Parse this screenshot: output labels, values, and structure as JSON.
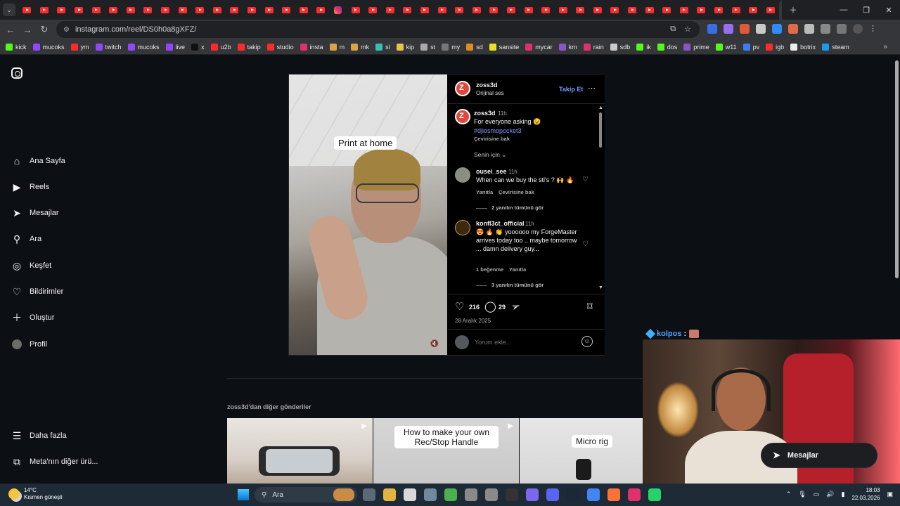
{
  "browser": {
    "url": "instagram.com/reel/DS0h0a8gXFZ/",
    "bookmarks": [
      "kick",
      "mucoks",
      "ym",
      "twitch",
      "mucoks",
      "live",
      "x",
      "u2b",
      "takip",
      "studio",
      "insta",
      "m",
      "mk",
      "sl",
      "kip",
      "st",
      "my",
      "sd",
      "sansite",
      "mycar",
      "km",
      "rain",
      "sdb",
      "ik",
      "dos",
      "prime",
      "w11",
      "pv",
      "igb",
      "botrix",
      "steam"
    ]
  },
  "sidebar": {
    "items": [
      {
        "label": "Ana Sayfa",
        "icon": "home-icon"
      },
      {
        "label": "Reels",
        "icon": "reels-icon"
      },
      {
        "label": "Mesajlar",
        "icon": "messages-icon"
      },
      {
        "label": "Ara",
        "icon": "search-icon"
      },
      {
        "label": "Keşfet",
        "icon": "explore-icon"
      },
      {
        "label": "Bildirimler",
        "icon": "heart-icon"
      },
      {
        "label": "Oluştur",
        "icon": "plus-icon"
      },
      {
        "label": "Profil",
        "icon": "avatar-icon"
      }
    ],
    "more": "Daha fazla",
    "meta": "Meta'nın diğer ürü..."
  },
  "post": {
    "video_caption": "Print at home",
    "author": "zoss3d",
    "audio": "Orijinal ses",
    "follow": "Takip Et",
    "caption": {
      "user": "zoss3d",
      "time": "11h",
      "text": "For everyone asking 😉",
      "hashtag": "#djiosmopocket3",
      "translate": "Çevirisine bak"
    },
    "sort": "Senin için",
    "comments": [
      {
        "user": "ousei_see",
        "time": "11h",
        "text": "When can we buy the stl's ? 🙌 🔥",
        "reply": "Yanıtla",
        "translate": "Çevirisine bak",
        "replies": "2 yanıtın tümünü gör"
      },
      {
        "user": "konfl3ct_official",
        "time": "11h",
        "text": "😍 🔥 👏 yoooooo my ForgeMaster arrives today too .. maybe tomorrow ... damn delivery guy...",
        "likes": "1 beğenme",
        "reply": "Yanıtla",
        "replies": "3 yanıtın tümünü gör"
      }
    ],
    "likes": "216",
    "comment_count": "29",
    "date": "28 Aralık 2025",
    "add_comment_placeholder": "Yorum ekle..."
  },
  "more_posts": {
    "title": "zoss3d'dan diğer gönderiler",
    "tiles": [
      {
        "caption": ""
      },
      {
        "caption": "How to make your own Rec/Stop Handle"
      },
      {
        "caption": "Micro rig"
      }
    ]
  },
  "overlay": {
    "chat_user": "kolpos",
    "chat_sep": ":"
  },
  "messages_pill": "Mesajlar",
  "taskbar": {
    "temp": "14°C",
    "weather": "Kısmen güneşli",
    "search": "Ara",
    "time": "18:03",
    "date": "22.03.2026"
  }
}
